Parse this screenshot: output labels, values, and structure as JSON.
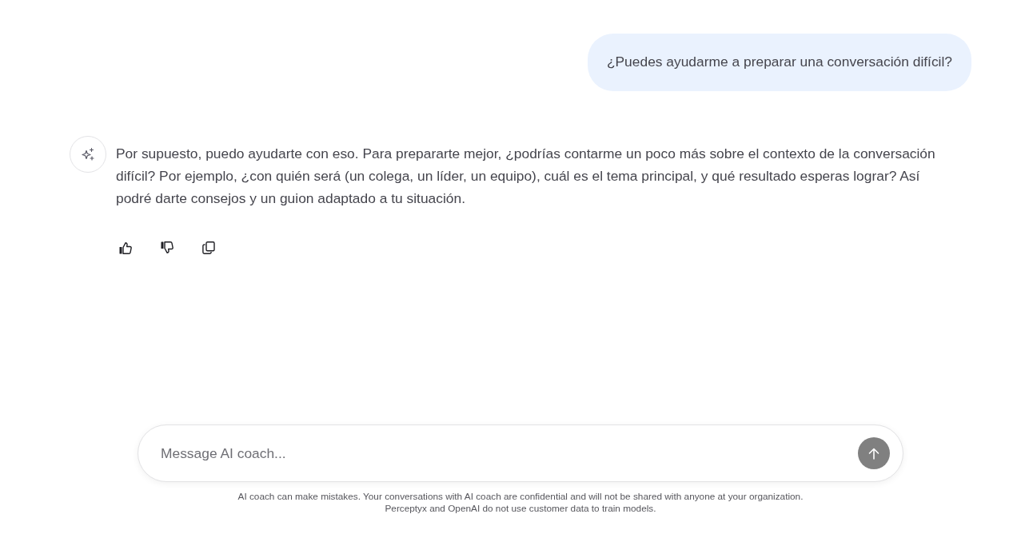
{
  "messages": [
    {
      "kind": "user",
      "text": "¿Puedes ayudarme a preparar una conversación difícil?"
    },
    {
      "kind": "assistant",
      "text": "Por supuesto, puedo ayudarte con eso. Para prepararte mejor, ¿podrías contarme un poco más sobre el contexto de la conversación difícil? Por ejemplo, ¿con quién será (un colega, un líder, un equipo), cuál es el tema principal, y qué resultado esperas lograr? Así podré darte consejos y un guion adaptado a tu situación.",
      "actions": [
        {
          "kind": "thumbs_up"
        },
        {
          "kind": "thumbs_down"
        },
        {
          "kind": "copy"
        }
      ]
    }
  ],
  "composer": {
    "placeholder": "Message AI coach...",
    "send_button": {
      "disabled": true
    }
  },
  "disclaimer": [
    "AI coach can make mistakes. Your conversations with AI coach are confidential and will not be shared with anyone at your organization.",
    "Perceptyx and OpenAI do not use customer data to train models."
  ]
}
